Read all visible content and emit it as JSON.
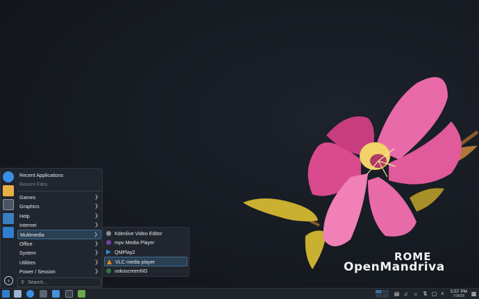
{
  "wallpaper": {
    "edition": "ROME",
    "brand": "OpenMandriva"
  },
  "launcher": {
    "favorites": [
      {
        "icon": "browser-icon"
      },
      {
        "icon": "files-icon"
      },
      {
        "icon": "terminal-icon"
      },
      {
        "icon": "image-icon"
      },
      {
        "icon": "help-icon"
      }
    ],
    "categories": [
      {
        "label": "Recent Applications",
        "chevron": false,
        "dim": false
      },
      {
        "label": "Recent Files",
        "chevron": false,
        "dim": true
      },
      {
        "label": "Games",
        "chevron": true,
        "dim": false
      },
      {
        "label": "Graphics",
        "chevron": true,
        "dim": false
      },
      {
        "label": "Help",
        "chevron": true,
        "dim": false
      },
      {
        "label": "Internet",
        "chevron": true,
        "dim": false
      },
      {
        "label": "Multimedia",
        "chevron": true,
        "dim": false,
        "active": true
      },
      {
        "label": "Office",
        "chevron": true,
        "dim": false
      },
      {
        "label": "System",
        "chevron": true,
        "dim": false
      },
      {
        "label": "Utilities",
        "chevron": true,
        "dim": false
      },
      {
        "label": "Power / Session",
        "chevron": true,
        "dim": false
      }
    ],
    "search_placeholder": "Search..."
  },
  "submenu": {
    "items": [
      {
        "label": "Kdenlive Video Editor",
        "icon": "kdenlive-icon",
        "color": "#8a8f99"
      },
      {
        "label": "mpv Media Player",
        "icon": "mpv-icon",
        "color": "#7b3fa0"
      },
      {
        "label": "QMPlay2",
        "icon": "qmplay2-icon",
        "color": "#2f8fd0"
      },
      {
        "label": "VLC media player",
        "icon": "vlc-icon",
        "color": "#f08a12",
        "active": true
      },
      {
        "label": "vokoscreenNG",
        "icon": "vokoscreen-icon",
        "color": "#2e7a46"
      }
    ]
  },
  "taskbar": {
    "time": "5:57 PM",
    "date": "7/30/25"
  },
  "colors": {
    "accent": "#3d6c92",
    "panel": "#20242b",
    "flower": "#e86aa8",
    "leaf": "#c9b030"
  }
}
